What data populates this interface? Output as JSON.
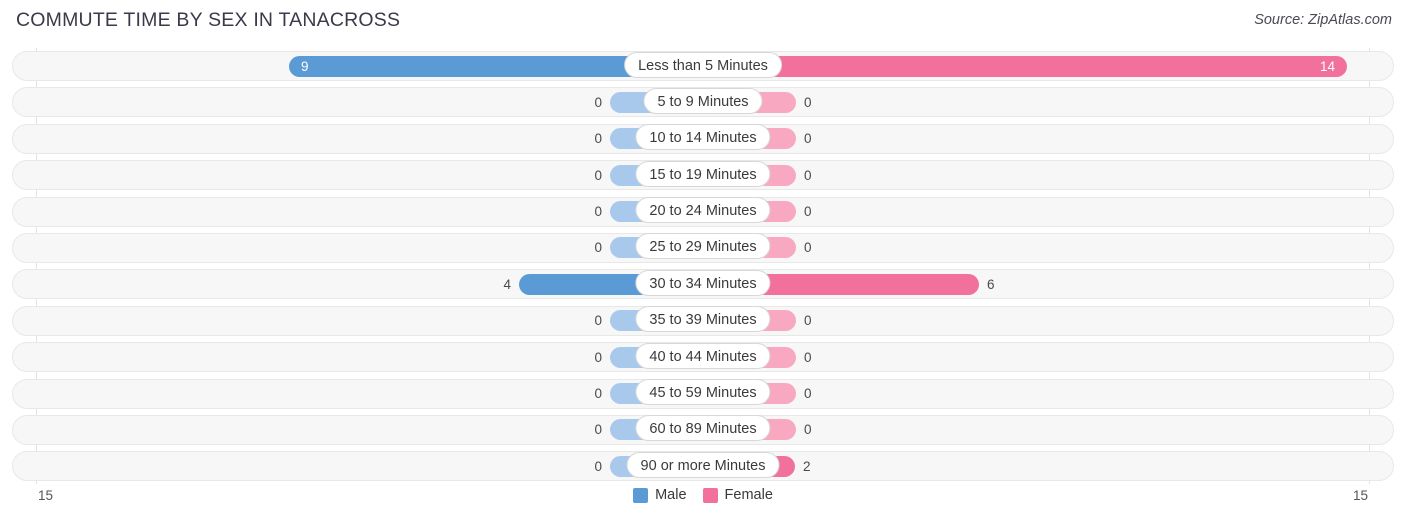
{
  "header": {
    "title": "COMMUTE TIME BY SEX IN TANACROSS",
    "source": "Source: ZipAtlas.com"
  },
  "legend": {
    "male_label": "Male",
    "female_label": "Female",
    "male_color": "#5b9bd5",
    "female_color": "#f2709c",
    "male_zero_color": "#a8c8ec",
    "female_zero_color": "#f8a8c0"
  },
  "axis": {
    "left_end_label": "15",
    "right_end_label": "15",
    "max": 15
  },
  "chart_data": {
    "type": "bar",
    "title": "COMMUTE TIME BY SEX IN TANACROSS",
    "orientation": "horizontal-diverging",
    "xlabel": "",
    "ylabel": "",
    "xlim": [
      15,
      15
    ],
    "grid": false,
    "legend_position": "bottom-center",
    "categories": [
      "Less than 5 Minutes",
      "5 to 9 Minutes",
      "10 to 14 Minutes",
      "15 to 19 Minutes",
      "20 to 24 Minutes",
      "25 to 29 Minutes",
      "30 to 34 Minutes",
      "35 to 39 Minutes",
      "40 to 44 Minutes",
      "45 to 59 Minutes",
      "60 to 89 Minutes",
      "90 or more Minutes"
    ],
    "series": [
      {
        "name": "Male",
        "values": [
          9,
          0,
          0,
          0,
          0,
          0,
          4,
          0,
          0,
          0,
          0,
          0
        ]
      },
      {
        "name": "Female",
        "values": [
          14,
          0,
          0,
          0,
          0,
          0,
          6,
          0,
          0,
          0,
          0,
          2
        ]
      }
    ]
  }
}
